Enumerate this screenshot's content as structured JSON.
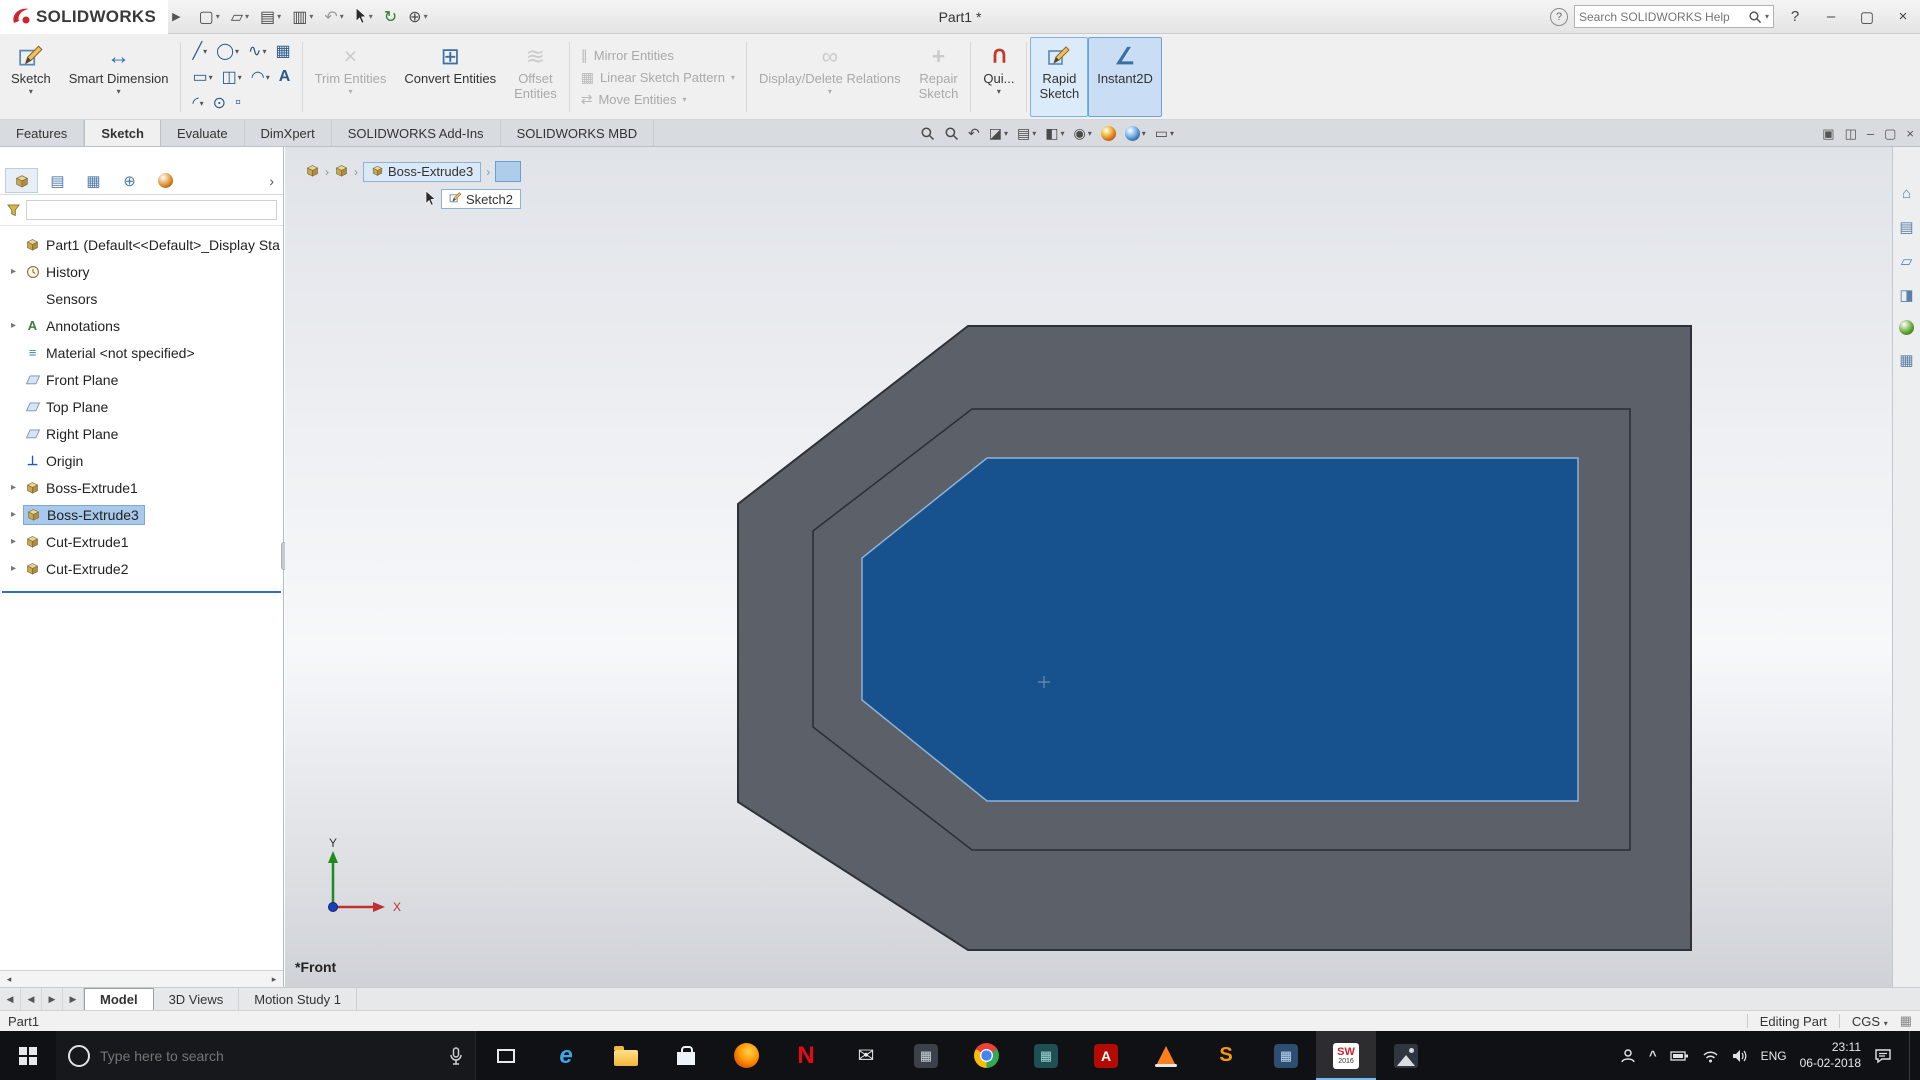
{
  "titlebar": {
    "brand": "SOLIDWORKS",
    "document_title": "Part1 *",
    "search_placeholder": "Search SOLIDWORKS Help"
  },
  "ribbon": {
    "sketch": "Sketch",
    "smart_dimension": "Smart Dimension",
    "trim_entities": "Trim Entities",
    "convert_entities": "Convert Entities",
    "offset_line1": "Offset",
    "offset_line2": "Entities",
    "mirror_entities": "Mirror Entities",
    "linear_sketch_pattern": "Linear Sketch Pattern",
    "move_entities": "Move Entities",
    "display_delete_relations": "Display/Delete Relations",
    "repair_line1": "Repair",
    "repair_line2": "Sketch",
    "quick_snaps": "Qui...",
    "rapid_line1": "Rapid",
    "rapid_line2": "Sketch",
    "instant2d": "Instant2D"
  },
  "ribbon_tabs": {
    "features": "Features",
    "sketch": "Sketch",
    "evaluate": "Evaluate",
    "dimxpert": "DimXpert",
    "addins": "SOLIDWORKS Add-Ins",
    "mbd": "SOLIDWORKS MBD"
  },
  "feature_tree": {
    "root": "Part1 (Default<<Default>_Display Sta",
    "items": [
      {
        "label": "History"
      },
      {
        "label": "Sensors"
      },
      {
        "label": "Annotations"
      },
      {
        "label": "Material <not specified>"
      },
      {
        "label": "Front Plane"
      },
      {
        "label": "Top Plane"
      },
      {
        "label": "Right Plane"
      },
      {
        "label": "Origin"
      },
      {
        "label": "Boss-Extrude1"
      },
      {
        "label": "Boss-Extrude3"
      },
      {
        "label": "Cut-Extrude1"
      },
      {
        "label": "Cut-Extrude2"
      }
    ]
  },
  "breadcrumb": {
    "feature": "Boss-Extrude3",
    "sketch": "Sketch2"
  },
  "viewport": {
    "view_label": "*Front",
    "axis_x": "X",
    "axis_y": "Y"
  },
  "doc_tabs": {
    "model": "Model",
    "views_3d": "3D Views",
    "motion": "Motion Study 1"
  },
  "statusbar": {
    "left": "Part1",
    "mode": "Editing Part",
    "units": "CGS"
  },
  "taskbar": {
    "search_placeholder": "Type here to search",
    "language": "ENG",
    "time": "23:11",
    "date": "06-02-2018",
    "solidworks_icon_text": "SW",
    "solidworks_icon_year": "2016"
  },
  "icons": {
    "caret": "▾",
    "flyout": "▶",
    "tree_arrow": "▸",
    "chevron_right": "›",
    "new_doc": "▢",
    "open_doc": "▱",
    "save_doc": "▤",
    "print_doc": "▥",
    "undo": "↶",
    "rebuild": "↻",
    "options": "⊕",
    "help": "?",
    "minimize": "–",
    "maximize": "▢",
    "close": "×",
    "dock1": "▣",
    "dock2": "◫",
    "line": "╱",
    "circle": "◯",
    "spline": "∿",
    "pattern": "▦",
    "rect": "▭",
    "slot": "◫",
    "arc": "◠",
    "text_tool": "A",
    "fillet": "◜",
    "point": "⊙",
    "dot": "▫",
    "trim": "×",
    "convert": "⊞",
    "offset": "≋",
    "mirror": "∥",
    "move": "⇄",
    "relations": "∞",
    "repair": "+",
    "snaps": "∪",
    "smart_dim": "↔",
    "instant2d": "∠",
    "prev_view": "↶",
    "section": "◪",
    "orientation": "▤",
    "display_style": "◧",
    "hide_show": "◉",
    "view_settings": "▭",
    "history": "◷",
    "sensors": "◉",
    "annotations": "A",
    "material": "≡",
    "origin": "⊥",
    "home": "⌂",
    "design_library": "▤",
    "file_explorer": "▱",
    "view_palette": "◨",
    "custom_props": "▦",
    "panel_tab2": "▤",
    "panel_tab3": "▦",
    "panel_tab4": "⊕",
    "nav_first": "◀",
    "nav_prev": "◀",
    "nav_next": "▶",
    "nav_last": "▶",
    "scroll_left": "◂",
    "scroll_right": "▸",
    "edge_letter": "e",
    "netflix_letter": "N",
    "sublime_letter": "S",
    "acrobat_letter": "A",
    "mail": "✉",
    "app_glyph": "▦",
    "chevron_up": "^",
    "statusbar_icon": "▦"
  }
}
